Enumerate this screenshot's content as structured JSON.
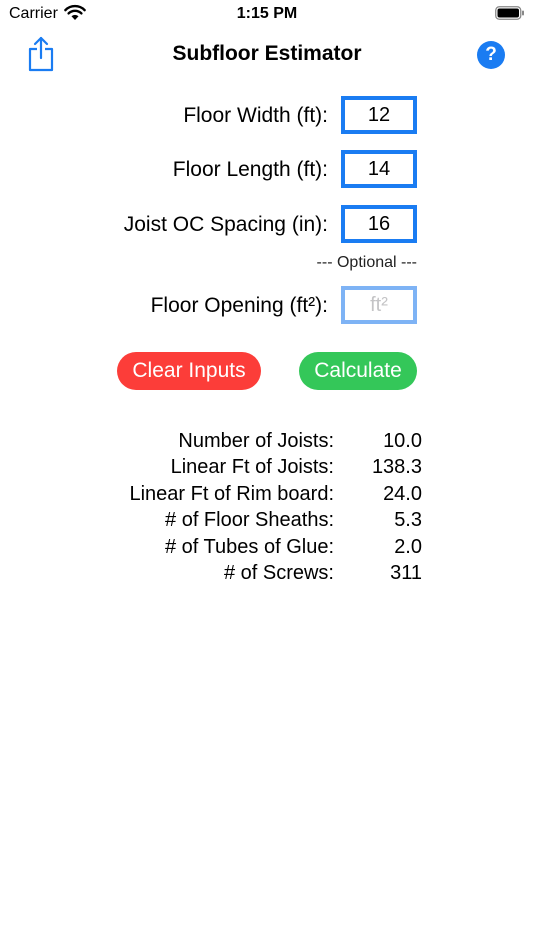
{
  "status_bar": {
    "carrier": "Carrier",
    "time": "1:15 PM"
  },
  "nav": {
    "title": "Subfloor Estimator",
    "help_label": "?"
  },
  "fields": [
    {
      "label": "Floor Width (ft):",
      "value": "12",
      "placeholder": ""
    },
    {
      "label": "Floor Length (ft):",
      "value": "14",
      "placeholder": ""
    },
    {
      "label": "Joist OC Spacing (in):",
      "value": "16",
      "placeholder": ""
    }
  ],
  "optional_label": "--- Optional ---",
  "opening": {
    "label": "Floor Opening (ft²):",
    "value": "",
    "placeholder": "ft²"
  },
  "buttons": {
    "clear": "Clear Inputs",
    "calculate": "Calculate"
  },
  "results": [
    {
      "label": "Number of Joists:",
      "value": "10.0"
    },
    {
      "label": "Linear Ft of Joists:",
      "value": "138.3"
    },
    {
      "label": "Linear Ft of Rim board:",
      "value": "24.0"
    },
    {
      "label": "# of Floor Sheaths:",
      "value": "5.3"
    },
    {
      "label": "# of Tubes of Glue:",
      "value": "2.0"
    },
    {
      "label": "# of Screws:",
      "value": "311"
    }
  ],
  "colors": {
    "accent": "#1a7cf2",
    "clear": "#fc3d39",
    "calculate": "#34c759"
  },
  "icons": {
    "share": "share-icon",
    "help": "help-icon",
    "wifi": "wifi-icon",
    "battery": "battery-icon"
  }
}
